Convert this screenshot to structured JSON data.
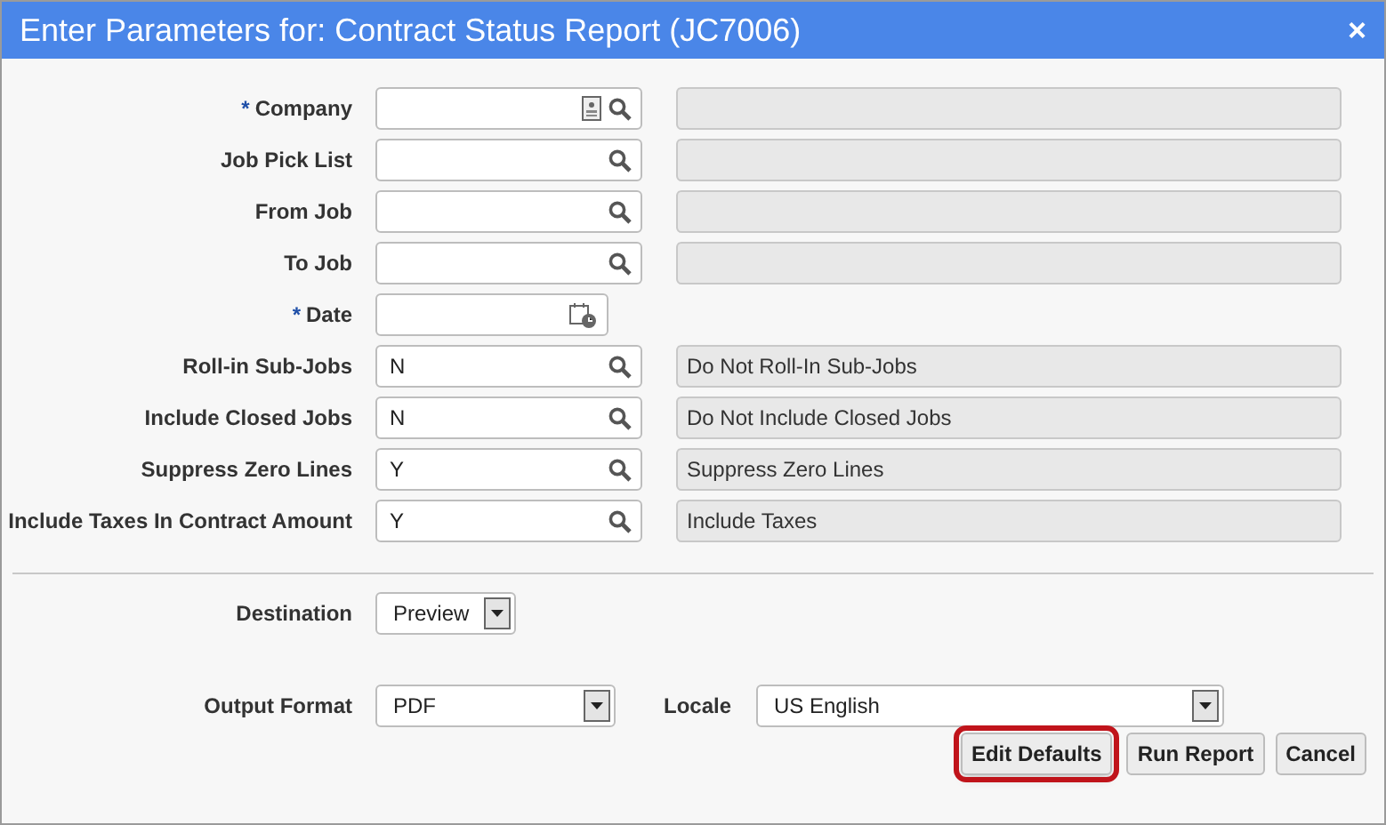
{
  "window": {
    "title": "Enter Parameters for: Contract Status Report (JC7006)",
    "close": "×"
  },
  "parameters": [
    {
      "label": "Company",
      "required_mark": "*",
      "kind": "card_lookup"
    },
    {
      "label": "Job Pick List",
      "kind": "lookup"
    },
    {
      "label": "From Job",
      "kind": "lookup"
    },
    {
      "label": "To Job",
      "kind": "lookup"
    },
    {
      "label": "Date",
      "required_mark": "*",
      "kind": "date"
    },
    {
      "label": "Roll-in Sub-Jobs",
      "kind": "lookup",
      "value": "N",
      "description": "Do Not Roll-In Sub-Jobs"
    },
    {
      "label": "Include Closed Jobs",
      "kind": "lookup",
      "value": "N",
      "description": "Do Not Include Closed Jobs"
    },
    {
      "label": "Suppress Zero Lines",
      "kind": "lookup",
      "value": "Y",
      "description": "Suppress Zero Lines"
    },
    {
      "label": "Include Taxes In Contract Amount",
      "kind": "lookup",
      "value": "Y",
      "description": "Include Taxes"
    }
  ],
  "destination": {
    "label": "Destination",
    "value": "Preview"
  },
  "output_format": {
    "label": "Output Format",
    "value": "PDF"
  },
  "locale": {
    "label": "Locale",
    "value": "US English"
  },
  "buttons": [
    {
      "label": "Edit Defaults",
      "highlighted": true
    },
    {
      "label": "Run Report",
      "highlighted": false
    },
    {
      "label": "Cancel",
      "highlighted": false
    }
  ]
}
